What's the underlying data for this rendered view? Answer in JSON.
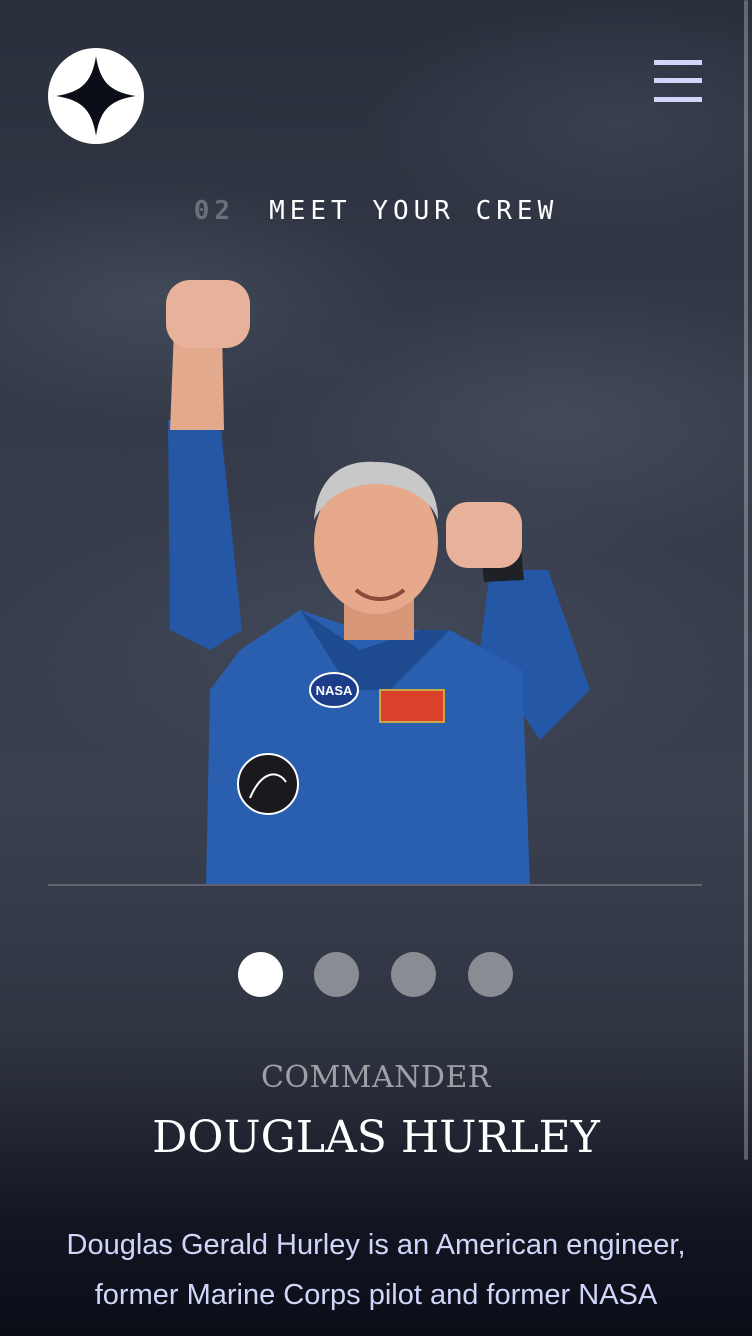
{
  "header": {
    "logo_icon": "four-point-star-icon",
    "menu_icon": "hamburger-menu-icon"
  },
  "page": {
    "number": "02",
    "title": "MEET YOUR CREW"
  },
  "crew": {
    "active_index": 0,
    "slides": 4,
    "role": "COMMANDER",
    "name": "DOUGLAS HURLEY",
    "bio": "Douglas Gerald Hurley is an American engineer, former Marine Corps pilot and former NASA",
    "patch_text": "NASA"
  },
  "colors": {
    "background": "#0b0d17",
    "accent": "#d0d6f9",
    "white": "#ffffff",
    "inactive_dot": "#8a8c93"
  }
}
